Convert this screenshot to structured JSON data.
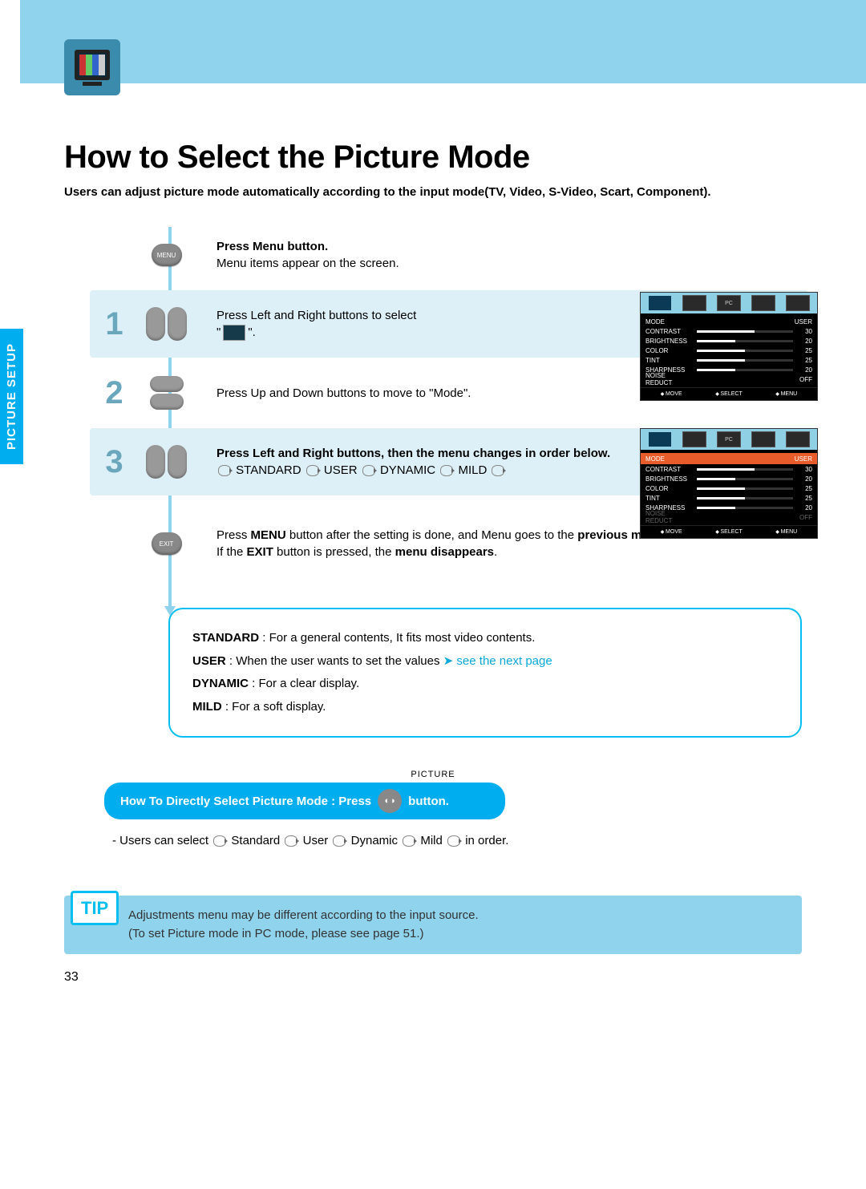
{
  "sidebar_label": "PICTURE SETUP",
  "title": "How to Select the Picture Mode",
  "intro": "Users can adjust picture mode automatically according to the input mode(TV, Video, S-Video, Scart, Component).",
  "menu_btn": "MENU",
  "exit_btn": "EXIT",
  "step0": {
    "bold": "Press Menu button.",
    "text": "Menu items appear on the screen."
  },
  "step1": {
    "num": "1",
    "bold_a": "Press Left and Right buttons to select",
    "bold_b": "\"",
    "bold_c": "\"."
  },
  "step2": {
    "num": "2",
    "bold": "Press Up and Down buttons to move to \"Mode\"."
  },
  "step3": {
    "num": "3",
    "bold": "Press Left and Right buttons, then the menu changes in order below.",
    "seq": [
      "STANDARD",
      "USER",
      "DYNAMIC",
      "MILD"
    ]
  },
  "exit_note": {
    "a": "Press ",
    "b": "MENU",
    "c": " button after the setting is done, and Menu goes to the ",
    "d": "previous menu",
    "e": ".",
    "f": "If the ",
    "g": "EXIT",
    "h": " button is pressed, the ",
    "i": "menu disappears",
    "j": "."
  },
  "defs": {
    "standard": {
      "k": "STANDARD",
      "v": " : For a general contents, It fits most video contents."
    },
    "user": {
      "k": "USER",
      "v": " : When the user wants to set the values  ",
      "link": "see the next page"
    },
    "dynamic": {
      "k": "DYNAMIC",
      "v": " : For a clear display."
    },
    "mild": {
      "k": "MILD",
      "v": " : For a soft display."
    }
  },
  "picture_label": "PICTURE",
  "pill": {
    "a": "How To Directly Select Picture Mode : Press",
    "b": "button."
  },
  "order_line": {
    "a": "- Users can select ",
    "seq": [
      "Standard",
      "User",
      "Dynamic",
      "Mild"
    ],
    "b": " in order."
  },
  "tip": {
    "label": "TIP",
    "l1": "Adjustments menu may be different according to the input source.",
    "l2": "(To set Picture mode in PC mode, please see page 51.)"
  },
  "page_num": "33",
  "osd": {
    "header": "MODE",
    "user": "USER",
    "rows": [
      {
        "lbl": "CONTRAST",
        "val": "30",
        "pct": 60
      },
      {
        "lbl": "BRIGHTNESS",
        "val": "20",
        "pct": 40
      },
      {
        "lbl": "COLOR",
        "val": "25",
        "pct": 50
      },
      {
        "lbl": "TINT",
        "val": "25",
        "pct": 50
      },
      {
        "lbl": "SHARPNESS",
        "val": "20",
        "pct": 40
      }
    ],
    "noise": {
      "lbl": "NOISE REDUCT",
      "val": "OFF"
    },
    "foot": [
      "MOVE",
      "SELECT",
      "MENU"
    ]
  }
}
